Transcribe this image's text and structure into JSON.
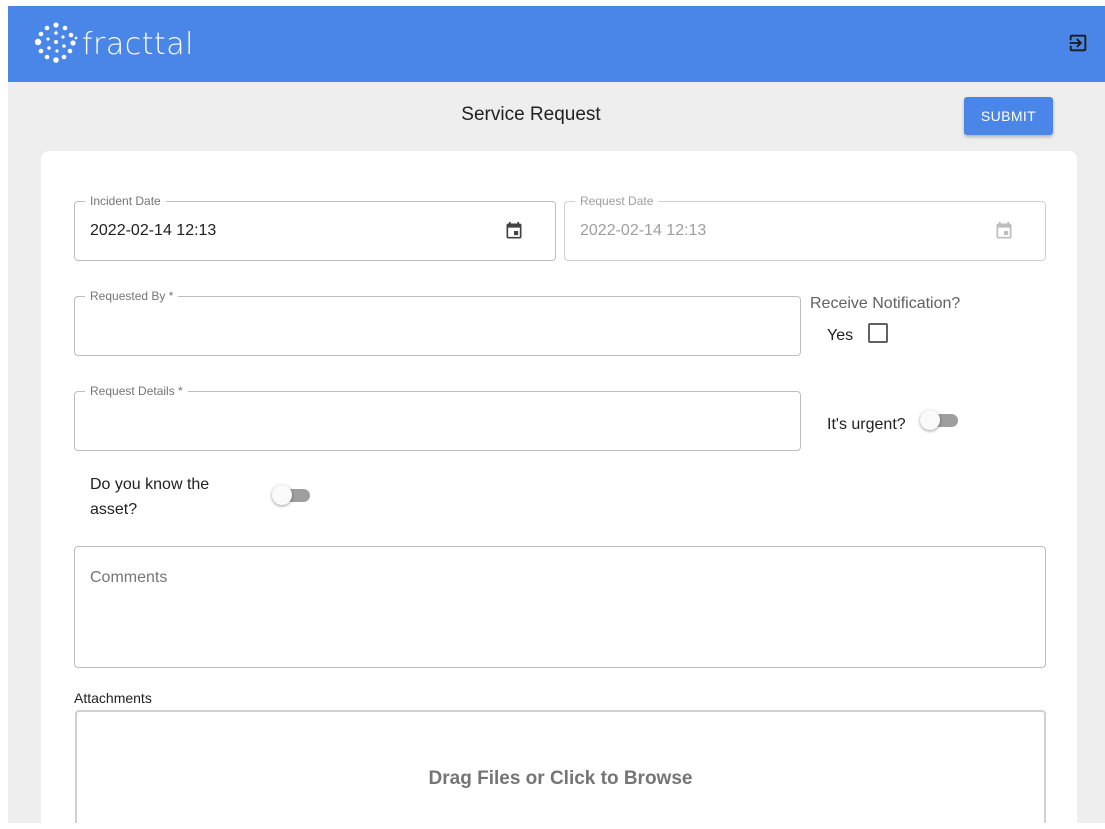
{
  "app": {
    "brand": "fracttal",
    "logo_icon": "dots-logo-icon",
    "logout_icon": "logout-icon",
    "accent": "#4a86e8"
  },
  "header": {
    "title": "Service Request",
    "submit_label": "SUBMIT"
  },
  "form": {
    "incident_date": {
      "label": "Incident Date",
      "value": "2022-02-14 12:13",
      "icon": "calendar-icon"
    },
    "request_date": {
      "label": "Request Date",
      "value": "2022-02-14 12:13",
      "icon": "calendar-icon",
      "disabled": true
    },
    "requested_by": {
      "label": "Requested By *",
      "value": ""
    },
    "receive_notification": {
      "label": "Receive Notification?",
      "option_label": "Yes",
      "checked": false
    },
    "request_details": {
      "label": "Request Details *",
      "value": ""
    },
    "urgent": {
      "label": "It's urgent?",
      "on": false
    },
    "know_asset": {
      "label": "Do you know the asset?",
      "on": false
    },
    "comments": {
      "placeholder": "Comments",
      "value": ""
    },
    "attachments": {
      "label": "Attachments",
      "dropzone_text": "Drag Files or Click to Browse"
    }
  }
}
